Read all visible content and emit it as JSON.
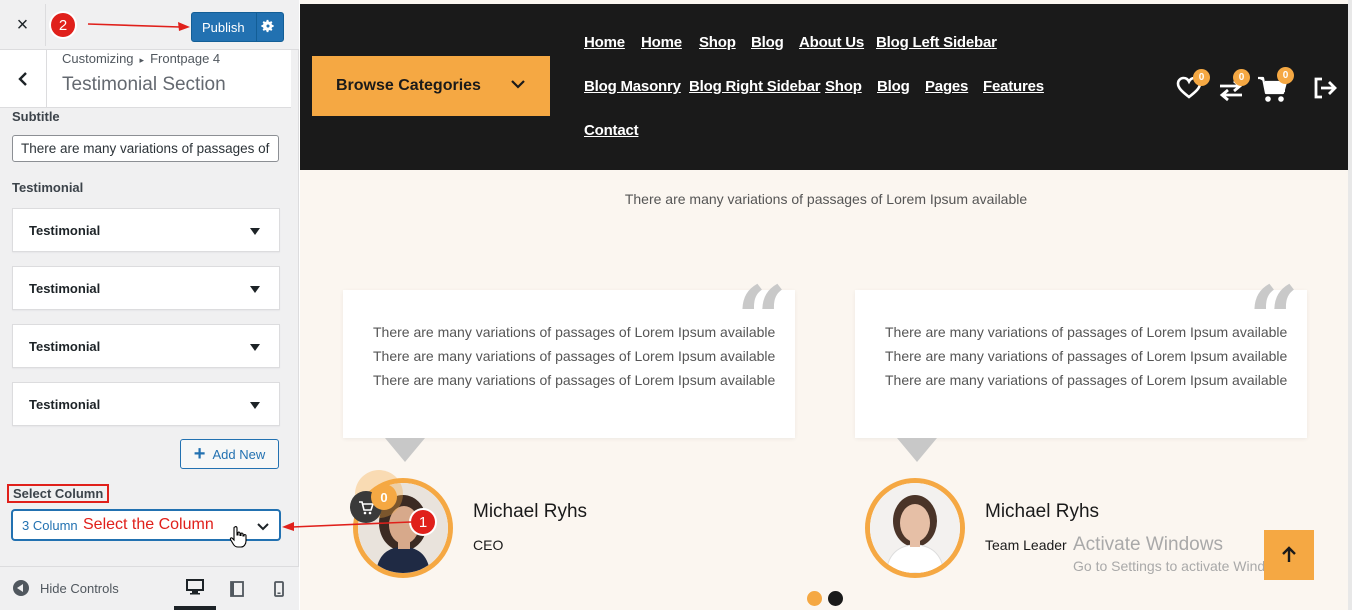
{
  "customizer": {
    "close_symbol": "×",
    "publish_label": "Publish",
    "breadcrumb": {
      "parent": "Customizing",
      "arrow": "▸",
      "current": "Frontpage 4"
    },
    "section_title": "Testimonial Section",
    "subtitle_label": "Subtitle",
    "subtitle_value": "There are many variations of passages of Lorem Ipsum available",
    "testimonial_label": "Testimonial",
    "testimonial_items": [
      {
        "label": "Testimonial"
      },
      {
        "label": "Testimonial"
      },
      {
        "label": "Testimonial"
      },
      {
        "label": "Testimonial"
      }
    ],
    "add_new_label": "Add New",
    "add_new_icon": "+",
    "select_column_label": "Select Column",
    "select_column_value": "3 Column",
    "hide_controls_label": "Hide Controls",
    "devices": [
      "desktop-icon",
      "tablet-icon",
      "mobile-icon"
    ]
  },
  "annotations": {
    "step_2": "2",
    "step_1": "1",
    "select_note": "Select the Column",
    "color": "#e0201b"
  },
  "site": {
    "browse_label": "Browse Categories",
    "nav_row1": [
      "Home",
      "Home",
      "Shop",
      "Blog",
      "About Us",
      "Blog Left Sidebar"
    ],
    "nav_row2": [
      "Blog Masonry",
      "Blog Right Sidebar",
      "Shop",
      "Blog",
      "Pages",
      "Features"
    ],
    "nav_row3": [
      "Contact"
    ],
    "wishlist_count": "0",
    "compare_count": "0",
    "cart_count": "0",
    "accent_color": "#f5a843",
    "header_color": "#1a1a1a"
  },
  "testimonials": {
    "subtitle": "There are many variations of passages of Lorem Ipsum available",
    "quote_mark": "“",
    "items": [
      {
        "lines": [
          "There are many variations of passages of Lorem Ipsum available",
          "There are many variations of passages of Lorem Ipsum available",
          "There are many variations of passages of Lorem Ipsum available"
        ],
        "name": "Michael Ryhs",
        "role": "CEO"
      },
      {
        "lines": [
          "There are many variations of passages of Lorem Ipsum available",
          "There are many variations of passages of Lorem Ipsum available",
          "There are many variations of passages of Lorem Ipsum available"
        ],
        "name": "Michael Ryhs",
        "role": "Team Leader"
      }
    ],
    "floating_cart_count": "0"
  },
  "watermark": {
    "title": "Activate Windows",
    "subtitle": "Go to Settings to activate Windows."
  }
}
